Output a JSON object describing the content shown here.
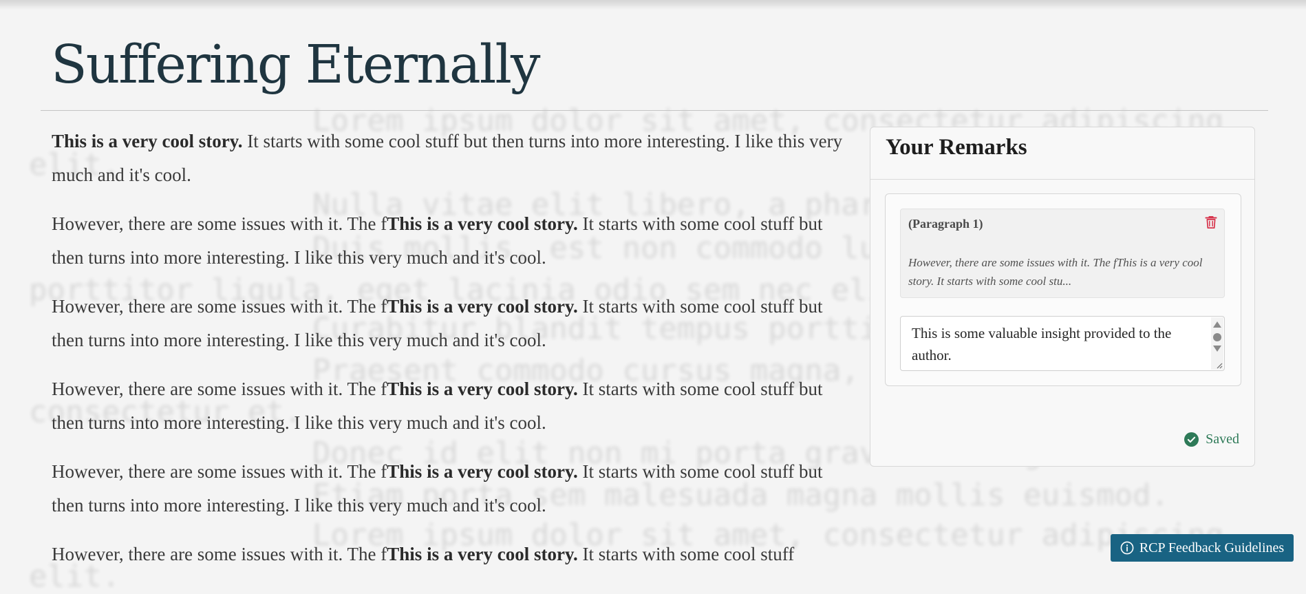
{
  "story": {
    "title": "Suffering Eternally",
    "paragraphs": [
      {
        "bold": "This is a very cool story.",
        "after": " It starts with some cool stuff but then turns into more interesting. I like this very much and it's cool."
      },
      {
        "before": "However, there are some issues with it. The f",
        "bold": "This is a very cool story.",
        "after": " It starts with some cool stuff but then turns into more interesting. I like this very much and it's cool."
      },
      {
        "before": "However, there are some issues with it. The f",
        "bold": "This is a very cool story.",
        "after": " It starts with some cool stuff but then turns into more interesting. I like this very much and it's cool."
      },
      {
        "before": "However, there are some issues with it. The f",
        "bold": "This is a very cool story.",
        "after": " It starts with some cool stuff but then turns into more interesting. I like this very much and it's cool."
      },
      {
        "before": "However, there are some issues with it. The f",
        "bold": "This is a very cool story.",
        "after": " It starts with some cool stuff but then turns into more interesting. I like this very much and it's cool."
      },
      {
        "before": "However, there are some issues with it. The f",
        "bold": "This is a very cool story.",
        "after": " It starts with some cool stuff"
      }
    ]
  },
  "background_text": [
    "Lorem ipsum dolor sit amet, consectetur adipiscing",
    "elit.",
    "Nulla vitae elit libero, a pharetra augue.",
    "Duis mollis, est non commodo luctus, nisi erat",
    "porttitor ligula, eget lacinia odio sem nec elit.",
    "Curabitur blandit tempus porttitor.",
    "Praesent commodo cursus magna, vel scelerisque",
    "consectetur et.",
    "Donec id elit non mi porta gravida at eget metus.",
    "Etiam porta sem malesuada magna mollis euismod.",
    "Lorem ipsum dolor sit amet, consectetur adipiscing",
    "elit."
  ],
  "remarks": {
    "title": "Your Remarks",
    "items": [
      {
        "label": "(Paragraph 1)",
        "excerpt": "However, there are some issues with it. The fThis is a very cool story. It starts with some cool stu...",
        "comment": "This is some valuable insight provided to the author.",
        "delete_icon": "trash-icon"
      }
    ],
    "status": "Saved",
    "status_icon": "check-circle-icon"
  },
  "guidelines_button": {
    "label": "RCP Feedback Guidelines",
    "icon": "info-icon"
  },
  "colors": {
    "title": "#1f3540",
    "button": "#196383",
    "saved": "#2e7a58",
    "delete": "#d7344c"
  }
}
